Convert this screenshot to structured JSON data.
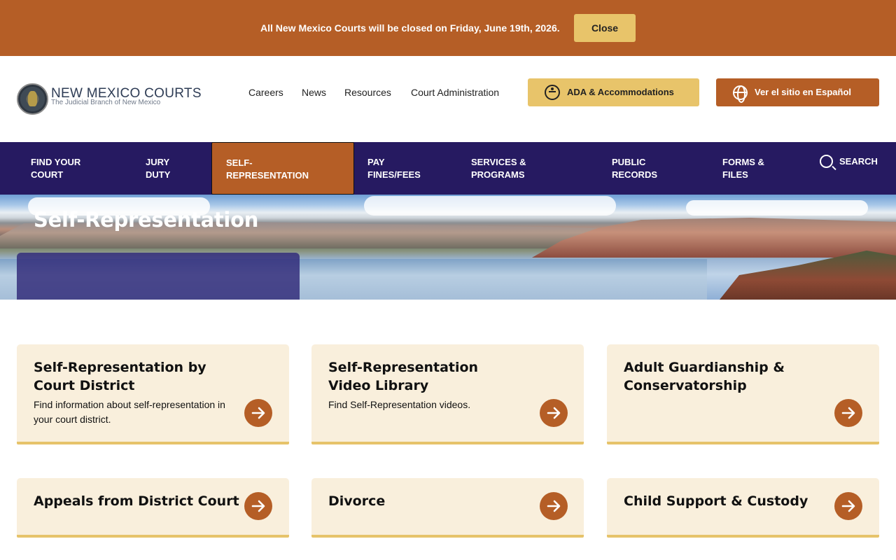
{
  "alert": {
    "message": "All New Mexico Courts will be closed on Friday, June 19th, 2026.",
    "close_label": "Close"
  },
  "header": {
    "logo_title": "NEW MEXICO COURTS",
    "logo_subtitle": "The Judicial Branch of New Mexico",
    "links": [
      "Careers",
      "News",
      "Resources",
      "Court Administration"
    ],
    "ada_label": "ADA & Accommodations",
    "spanish_label": "Ver el sitio en Español"
  },
  "nav": {
    "items": [
      {
        "label": "Find your court"
      },
      {
        "label": "Jury duty"
      },
      {
        "label": "Self-representation",
        "active": true
      },
      {
        "label": "Pay fines/fees"
      },
      {
        "label": "Services & programs"
      },
      {
        "label": "Public records"
      },
      {
        "label": "Forms & files"
      }
    ],
    "search_label": "SEARCH"
  },
  "hero": {
    "title": "Self-Representation"
  },
  "cards": [
    {
      "title": "Self-Representation by Court District",
      "description": "Find information about self-representation in your court district."
    },
    {
      "title": "Self-Representation Video Library",
      "description": "Find Self-Representation videos."
    },
    {
      "title": "Adult Guardianship & Conservatorship",
      "description": ""
    },
    {
      "title": "Appeals from District Court",
      "description": ""
    },
    {
      "title": "Divorce",
      "description": ""
    },
    {
      "title": "Child Support & Custody",
      "description": ""
    }
  ],
  "colors": {
    "brand_orange": "#b55e26",
    "gold": "#e8c46a",
    "nav_purple": "#261a61",
    "card_bg": "#f9efdc"
  }
}
